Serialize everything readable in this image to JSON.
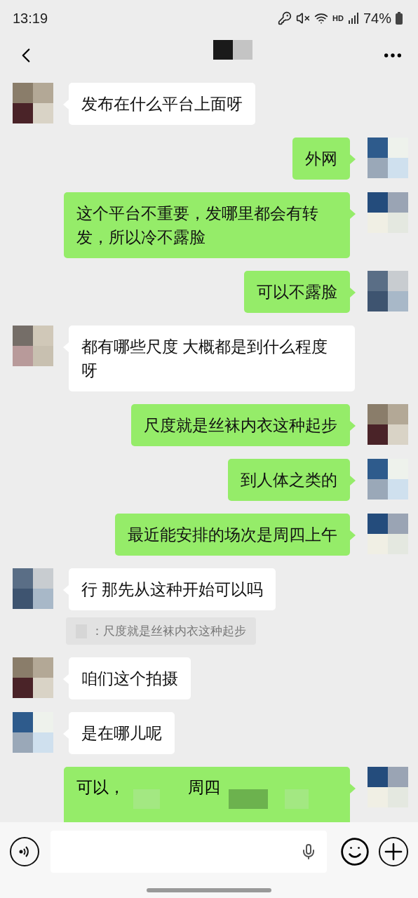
{
  "status_bar": {
    "time": "13:19",
    "network": "HD",
    "battery": "74%"
  },
  "messages": [
    {
      "kind": "text",
      "outgoing": false,
      "text": "发布在什么平台上面呀"
    },
    {
      "kind": "text",
      "outgoing": true,
      "text": "外网"
    },
    {
      "kind": "text",
      "outgoing": true,
      "text": "这个平台不重要，发哪里都会有转发，所以冷不露脸"
    },
    {
      "kind": "text",
      "outgoing": true,
      "text": "可以不露脸"
    },
    {
      "kind": "text",
      "outgoing": false,
      "text": "都有哪些尺度 大概都是到什么程度呀"
    },
    {
      "kind": "text",
      "outgoing": true,
      "text": "尺度就是丝袜内衣这种起步"
    },
    {
      "kind": "text",
      "outgoing": true,
      "text": "到人体之类的"
    },
    {
      "kind": "text",
      "outgoing": true,
      "text": "最近能安排的场次是周四上午"
    },
    {
      "kind": "text",
      "outgoing": false,
      "text": "行 那先从这种开始可以吗"
    },
    {
      "kind": "quote",
      "text": "：尺度就是丝袜内衣这种起步"
    },
    {
      "kind": "text",
      "outgoing": false,
      "text": "咱们这个拍摄"
    },
    {
      "kind": "text",
      "outgoing": false,
      "text": "是在哪儿呢"
    },
    {
      "kind": "redacted",
      "outgoing": true,
      "parts": [
        "可以，",
        "周四"
      ]
    }
  ]
}
